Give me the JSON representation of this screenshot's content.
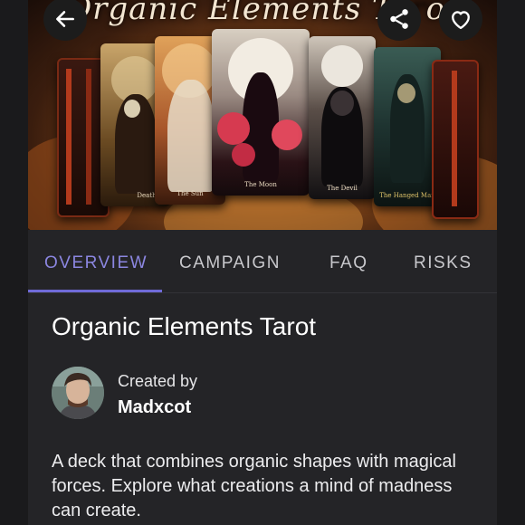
{
  "hero": {
    "title": "Organic Elements T",
    "title_tail": "ot",
    "cards": [
      {
        "caption": "Death"
      },
      {
        "caption": "The Sun"
      },
      {
        "caption": "The Moon"
      },
      {
        "caption": "The Devil"
      },
      {
        "caption": "The Hanged Man"
      }
    ],
    "icons": {
      "back": "arrow-left-icon",
      "share": "share-icon",
      "favorite": "heart-icon"
    }
  },
  "tabs": [
    {
      "label": "OVERVIEW",
      "active": true
    },
    {
      "label": "CAMPAIGN",
      "active": false
    },
    {
      "label": "FAQ",
      "active": false
    },
    {
      "label": "RISKS",
      "active": false
    }
  ],
  "project": {
    "title": "Organic Elements Tarot",
    "created_by_label": "Created by",
    "creator_name": "Madxcot",
    "description": "A deck that combines organic shapes with magical forces. Explore what creations a mind of madness can create."
  },
  "colors": {
    "accent": "#6f6ad8",
    "active_tab_text": "#8b86e0",
    "background": "#242427"
  }
}
